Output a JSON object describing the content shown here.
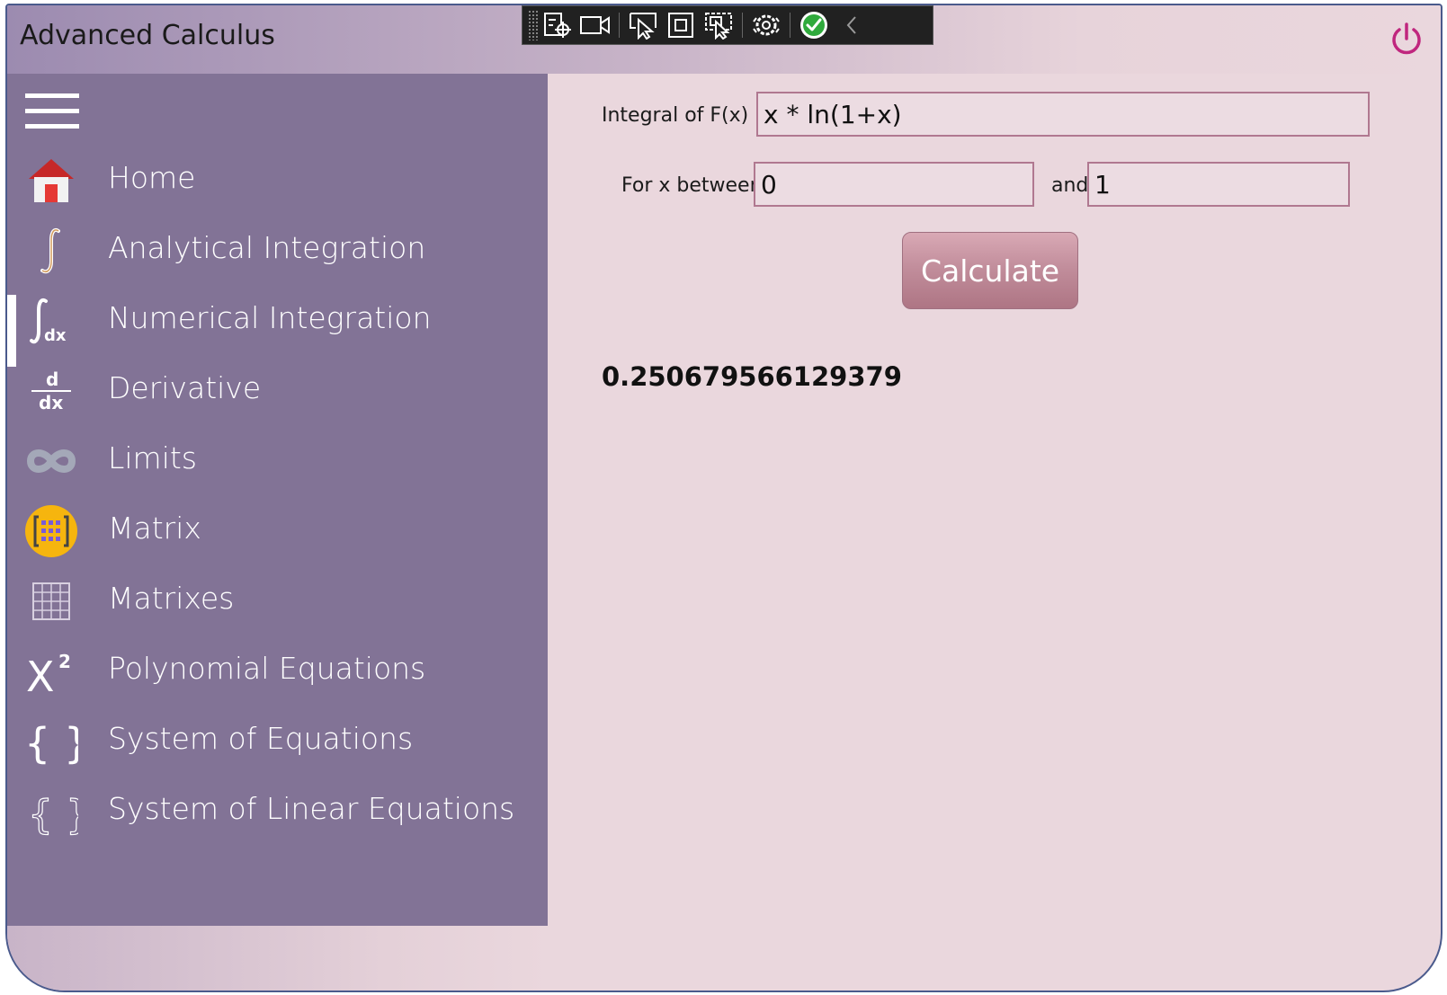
{
  "window": {
    "title": "Advanced Calculus"
  },
  "toolbar": {
    "tools": [
      "select-element-icon",
      "record-icon",
      "pointer-select-icon",
      "element-bounds-icon",
      "track-focus-icon",
      "settings-icon",
      "checkmark-icon",
      "collapse-chevron-icon"
    ]
  },
  "sidebar": {
    "items": [
      {
        "label": "Home",
        "icon": "home-icon"
      },
      {
        "label": "Analytical Integration",
        "icon": "integral-icon"
      },
      {
        "label": "Numerical Integration",
        "icon": "integral-dx-icon",
        "selected": true
      },
      {
        "label": "Derivative",
        "icon": "derivative-icon"
      },
      {
        "label": "Limits",
        "icon": "infinity-icon"
      },
      {
        "label": "Matrix",
        "icon": "matrix-icon"
      },
      {
        "label": "Matrixes",
        "icon": "grid-icon"
      },
      {
        "label": "Polynomial Equations",
        "icon": "x-squared-icon"
      },
      {
        "label": "System of Equations",
        "icon": "braces-icon"
      },
      {
        "label": "System of Linear Equations",
        "icon": "braces-outline-icon"
      }
    ]
  },
  "main": {
    "integral_label": "Integral of F(x) =",
    "function_value": "x * ln(1+x)",
    "for_label": "For x between",
    "lower_value": "0",
    "and_label": "and",
    "upper_value": "1",
    "calculate_label": "Calculate",
    "result": "0.250679566129379"
  },
  "colors": {
    "sidebar_bg": "#827396",
    "content_bg": "#ead7dd",
    "field_border": "#b07890",
    "button": "#c28e9c",
    "power_icon": "#c0267e"
  }
}
